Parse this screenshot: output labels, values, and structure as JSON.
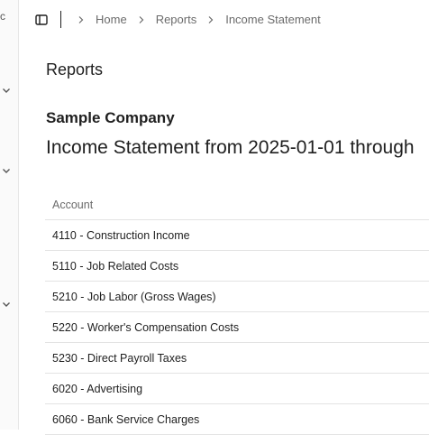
{
  "breadcrumb": {
    "items": [
      {
        "label": "Home"
      },
      {
        "label": "Reports"
      },
      {
        "label": "Income Statement"
      }
    ]
  },
  "page": {
    "title": "Reports",
    "company": "Sample Company",
    "statement_title": "Income Statement from 2025-01-01 through"
  },
  "table": {
    "columns": [
      "Account"
    ],
    "rows": [
      {
        "account": "4110 - Construction Income"
      },
      {
        "account": "5110 - Job Related Costs"
      },
      {
        "account": "5210 - Job Labor (Gross Wages)"
      },
      {
        "account": "5220 - Worker's Compensation Costs"
      },
      {
        "account": "5230 - Direct Payroll Taxes"
      },
      {
        "account": "6020 - Advertising"
      },
      {
        "account": "6060 - Bank Service Charges"
      }
    ]
  }
}
